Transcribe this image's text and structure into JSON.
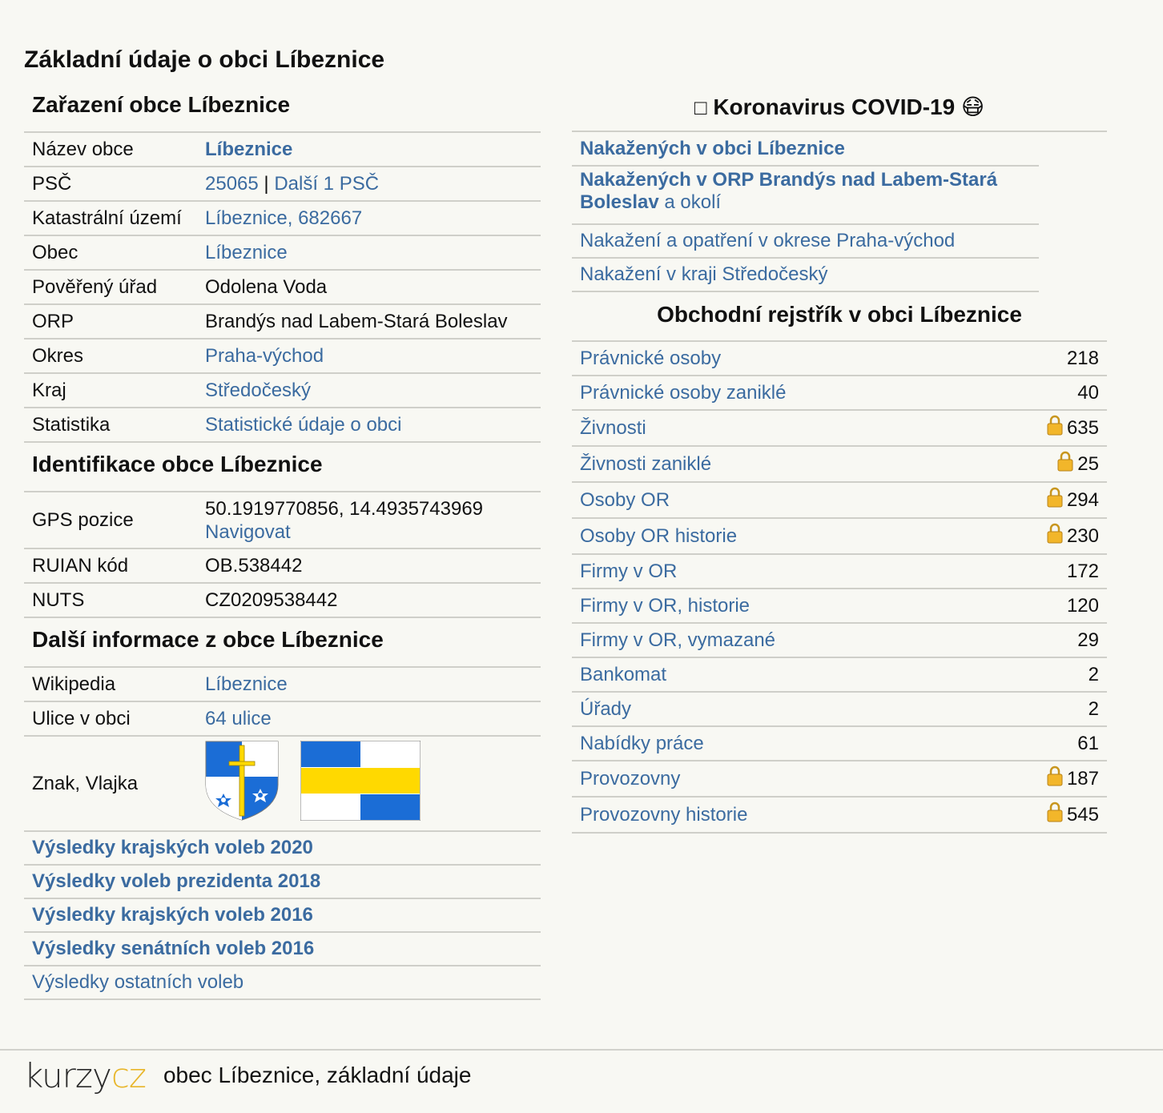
{
  "page_title": "Základní údaje o obci Líbeznice",
  "zarazeni": {
    "heading": "Zařazení obce Líbeznice",
    "rows": [
      {
        "label": "Název obce",
        "value": "Líbeznice"
      },
      {
        "label": "PSČ",
        "value_a": "25065",
        "sep": " | ",
        "value_b": "Další 1 PSČ"
      },
      {
        "label": "Katastrální území",
        "value": "Líbeznice, 682667"
      },
      {
        "label": "Obec",
        "value": "Líbeznice"
      },
      {
        "label": "Pověřený úřad",
        "value": "Odolena Voda"
      },
      {
        "label": "ORP",
        "value": "Brandýs nad Labem-Stará Boleslav"
      },
      {
        "label": "Okres",
        "value": "Praha-východ"
      },
      {
        "label": "Kraj",
        "value": "Středočeský"
      },
      {
        "label": "Statistika",
        "value": "Statistické údaje o obci"
      }
    ]
  },
  "identifikace": {
    "heading": "Identifikace obce Líbeznice",
    "gps_label": "GPS pozice",
    "gps_value": "50.1919770856, 14.4935743969",
    "gps_link": "Navigovat",
    "ruian_label": "RUIAN kód",
    "ruian_value": "OB.538442",
    "nuts_label": "NUTS",
    "nuts_value": "CZ0209538442"
  },
  "dalsi": {
    "heading": "Další informace z obce Líbeznice",
    "wiki_label": "Wikipedia",
    "wiki_value": "Líbeznice",
    "ulice_label": "Ulice v obci",
    "ulice_value": "64 ulice",
    "znak_label": "Znak, Vlajka"
  },
  "volby": [
    "Výsledky krajských voleb 2020",
    "Výsledky voleb prezidenta 2018",
    "Výsledky krajských voleb 2016",
    "Výsledky senátních voleb 2016",
    "Výsledky ostatních voleb"
  ],
  "covid": {
    "heading": "Koronavirus COVID-19",
    "heading_icon": "□",
    "heading_emoji": "😷",
    "item1": "Nakažených v obci Líbeznice",
    "item2_bold": "Nakažených v ORP Brandýs nad Labem-Stará Boleslav",
    "item2_rest": " a okolí",
    "item3": "Nakažení a opatření v okrese Praha-východ",
    "item4": "Nakažení v kraji Středočeský"
  },
  "obchodni": {
    "heading": "Obchodní rejstřík v obci Líbeznice",
    "rows": [
      {
        "label": "Právnické osoby",
        "value": "218",
        "locked": false
      },
      {
        "label": "Právnické osoby zaniklé",
        "value": "40",
        "locked": false
      },
      {
        "label": "Živnosti",
        "value": "635",
        "locked": true
      },
      {
        "label": "Živnosti zaniklé",
        "value": "25",
        "locked": true
      },
      {
        "label": "Osoby OR",
        "value": "294",
        "locked": true
      },
      {
        "label": "Osoby OR historie",
        "value": "230",
        "locked": true
      },
      {
        "label": "Firmy v OR",
        "value": "172",
        "locked": false
      },
      {
        "label": "Firmy v OR, historie",
        "value": "120",
        "locked": false
      },
      {
        "label": "Firmy v OR, vymazané",
        "value": "29",
        "locked": false
      },
      {
        "label": "Bankomat",
        "value": "2",
        "locked": false
      },
      {
        "label": "Úřady",
        "value": "2",
        "locked": false
      },
      {
        "label": "Nabídky práce",
        "value": "61",
        "locked": false
      },
      {
        "label": "Provozovny",
        "value": "187",
        "locked": true
      },
      {
        "label": "Provozovny historie",
        "value": "545",
        "locked": true
      }
    ]
  },
  "footer": {
    "logo_left": "kurzy",
    "logo_right": "cz",
    "text": "obec Líbeznice, základní údaje"
  },
  "colors": {
    "link": "#3b6ba0",
    "background": "#f8f8f3",
    "logo_accent": "#e8b62b",
    "flag_blue": "#1b6dd6",
    "flag_yellow": "#ffd900"
  }
}
